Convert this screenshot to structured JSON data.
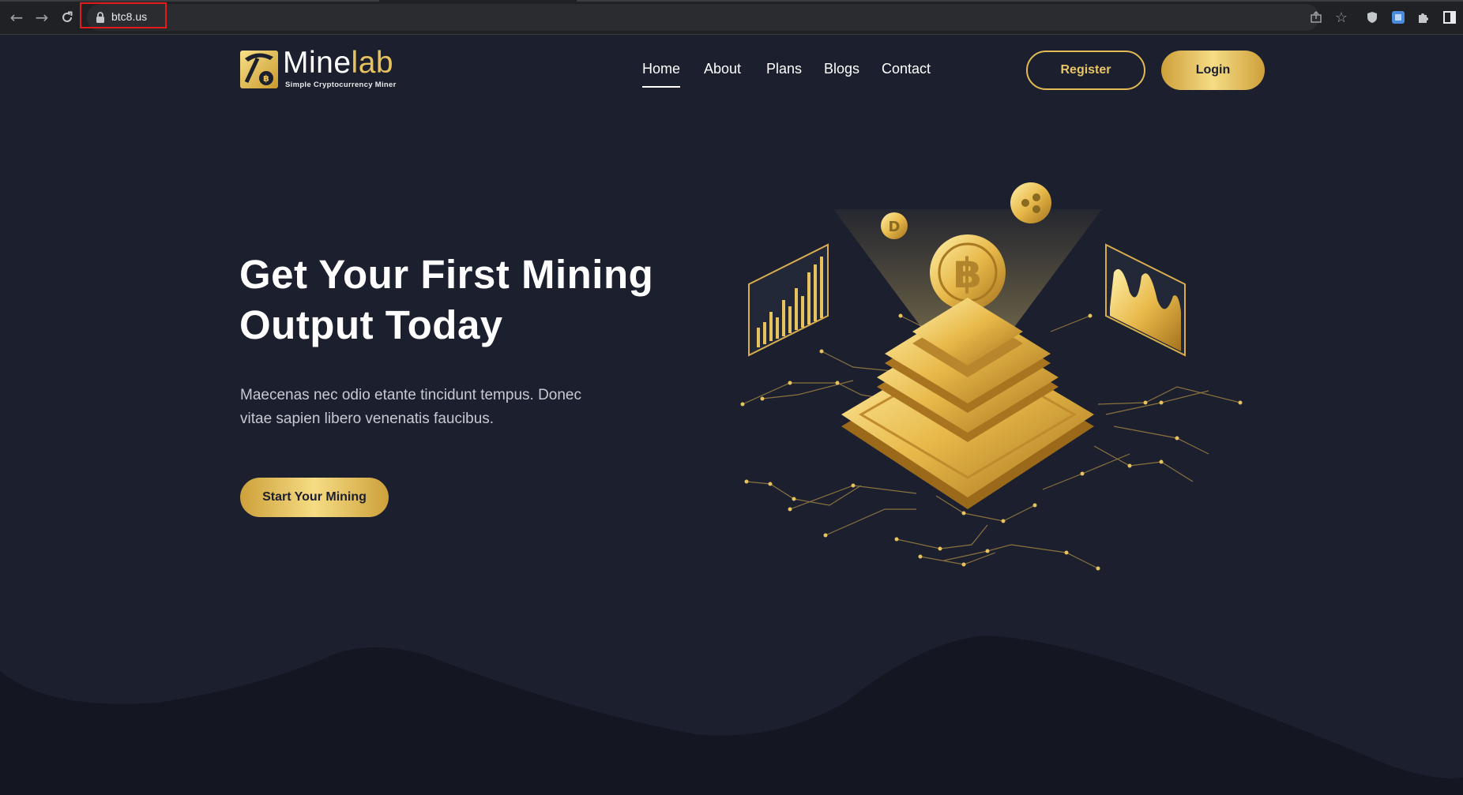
{
  "browser": {
    "url": "btc8.us",
    "icons": [
      "back-arrow-icon",
      "forward-arrow-icon",
      "reload-icon",
      "lock-icon",
      "share-icon",
      "star-icon",
      "shield-icon",
      "extension-icon",
      "puzzle-icon",
      "sidebar-icon"
    ]
  },
  "header": {
    "logo": {
      "name_main": "Mine",
      "name_accent": "lab",
      "tagline": "Simple Cryptocurrency Miner"
    },
    "nav": [
      {
        "label": "Home",
        "active": true
      },
      {
        "label": "About",
        "active": false
      },
      {
        "label": "Plans",
        "active": false
      },
      {
        "label": "Blogs",
        "active": false
      },
      {
        "label": "Contact",
        "active": false
      }
    ],
    "register_label": "Register",
    "login_label": "Login"
  },
  "hero": {
    "title_line1": "Get Your First Mining",
    "title_line2": "Output Today",
    "description": "Maecenas nec odio etante tincidunt tempus. Donec vitae sapien libero venenatis faucibus.",
    "cta_label": "Start Your Mining"
  },
  "colors": {
    "background": "#1b1f2e",
    "gold": "#e3bb55",
    "wave": "#141722"
  }
}
